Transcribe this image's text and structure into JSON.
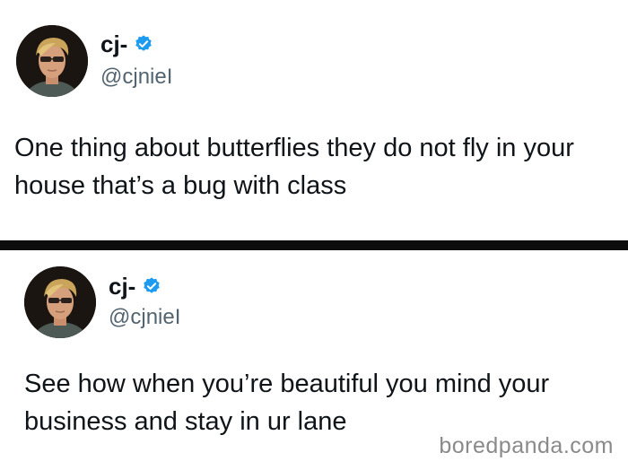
{
  "tweets": [
    {
      "display_name": "cj-",
      "handle": "@cjnieI",
      "text_line1": "One thing about butterflies they do not fly in your",
      "text_line2": "house that’s a bug with class",
      "avatar_icon": "profile-photo",
      "verified_icon": "verified-badge-icon"
    },
    {
      "display_name": "cj-",
      "handle": "@cjnieI",
      "text_line1": "See how when you’re beautiful you mind your",
      "text_line2": "business and stay in ur lane",
      "avatar_icon": "profile-photo",
      "verified_icon": "verified-badge-icon"
    }
  ],
  "watermark": "boredpanda.com",
  "colors": {
    "verified_blue": "#1d9bf0",
    "name": "#0f1419",
    "handle": "#536471",
    "divider": "#0d0d0d",
    "watermark": "#8a8a8a"
  }
}
